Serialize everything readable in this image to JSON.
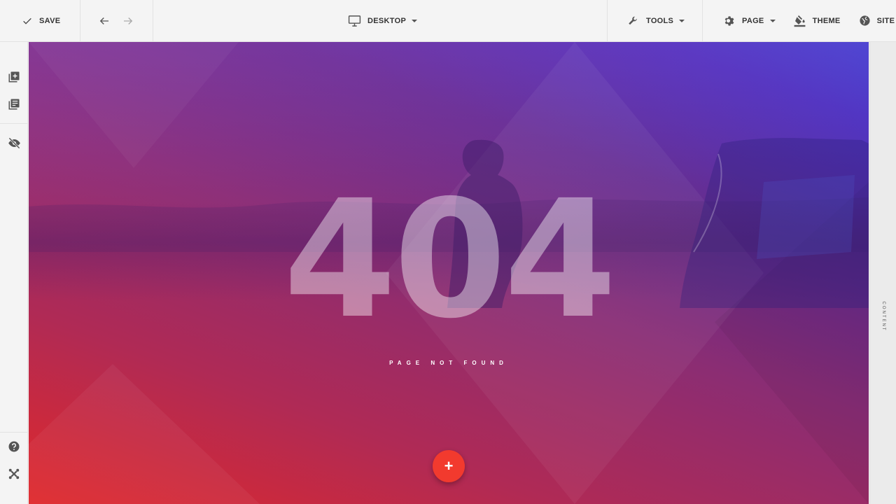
{
  "toolbar": {
    "save_label": "SAVE",
    "device_label": "DESKTOP",
    "tools_label": "TOOLS",
    "page_label": "PAGE",
    "theme_label": "THEME",
    "site_label": "SITE"
  },
  "hero": {
    "title": "404",
    "subtitle": "PAGE NOT FOUND",
    "add_label": "+"
  },
  "right_panel": {
    "label": "CONTENT"
  },
  "icons": {
    "save": "check-icon",
    "undo": "arrow-left-icon",
    "redo": "arrow-right-icon",
    "device": "monitor-icon",
    "tools": "wrench-icon",
    "page": "gear-icon",
    "theme": "paint-bucket-icon",
    "site": "globe-icon",
    "add_block": "add-block-icon",
    "library": "library-icon",
    "hide": "eye-off-icon",
    "help": "help-icon",
    "brand": "joomla-icon"
  },
  "colors": {
    "fab": "#f23a2e",
    "gradient_start": "#e0282a",
    "gradient_end": "#2541dd"
  }
}
